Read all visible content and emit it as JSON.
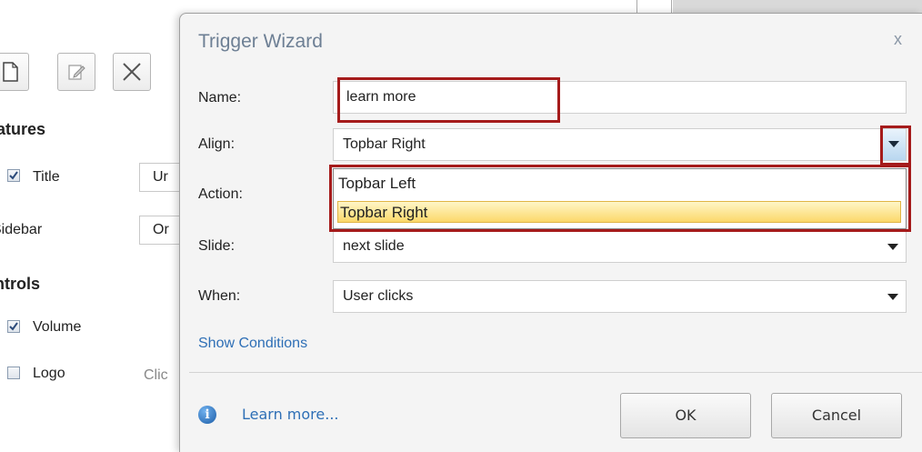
{
  "background": {
    "sections": {
      "features": "atures",
      "controls": "ntrols"
    },
    "rows": {
      "title": {
        "label": "Title",
        "checked": true,
        "box_value": "Ur"
      },
      "sidebar": {
        "label": "Sidebar",
        "box_value": "Or"
      },
      "volume": {
        "label": "Volume",
        "checked": true
      },
      "logo": {
        "label": "Logo",
        "checked": false,
        "hint": "Clic"
      }
    },
    "toolbar_icons": [
      "new-icon",
      "edit-icon",
      "delete-icon"
    ]
  },
  "dialog": {
    "title": "Trigger Wizard",
    "close_glyph": "x",
    "fields": {
      "name": {
        "label": "Name:",
        "value": "learn more"
      },
      "align": {
        "label": "Align:",
        "value": "Topbar Right"
      },
      "action": {
        "label": "Action:"
      },
      "slide": {
        "label": "Slide:",
        "value": "next slide"
      },
      "when": {
        "label": "When:",
        "value": "User clicks"
      }
    },
    "align_options": [
      "Topbar Left",
      "Topbar Right"
    ],
    "align_selected": "Topbar Right",
    "show_conditions": "Show Conditions",
    "learn_more": "Learn more...",
    "buttons": {
      "ok": "OK",
      "cancel": "Cancel"
    },
    "highlight_color": "#a51b1b"
  }
}
